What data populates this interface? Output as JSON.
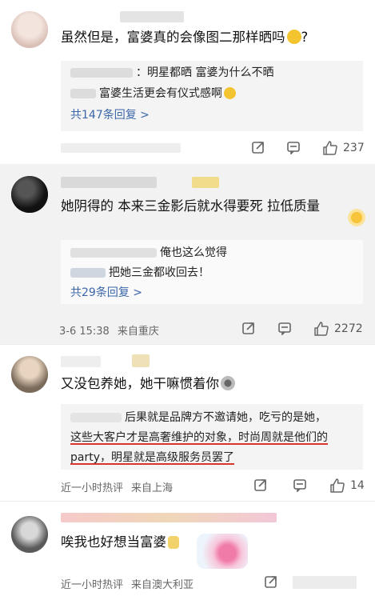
{
  "comments": [
    {
      "text": "虽然但是，富婆真的会像图二那样晒吗",
      "suffix": "?",
      "replies": [
        {
          "text": "：明星都晒 富婆为什么不晒"
        },
        {
          "text": "富婆生活更会有仪式感啊"
        }
      ],
      "more_label": "共147条回复 >",
      "likes": "237"
    },
    {
      "text": "她阴得的 本来三金影后就水得要死 拉低质量",
      "replies": [
        {
          "text": "俺也这么觉得"
        },
        {
          "text": "把她三金都收回去！"
        }
      ],
      "more_label": "共29条回复 >",
      "time": "3-6 15:38",
      "location": "来自重庆",
      "likes": "2272"
    },
    {
      "text": "又没包养她，她干嘛惯着你",
      "quote_lines": [
        "后果就是品牌方不邀请她，吃亏的是她，",
        "这些大客户才是高奢维护的对象，时尚周就是他们的",
        "party，明星就是高级服务员罢了"
      ],
      "time": "近一小时热评",
      "location": "来自上海",
      "likes": "14"
    },
    {
      "text": "唉我也好想当富婆",
      "time": "近一小时热评",
      "location": "来自澳大利亚"
    }
  ],
  "icons": {
    "share": "share-icon",
    "comment": "comment-icon",
    "like": "thumbs-up-icon"
  },
  "colors": {
    "link": "#3b66a8",
    "underline": "#d8362a",
    "highlight_bg": "#f2f2f2"
  }
}
